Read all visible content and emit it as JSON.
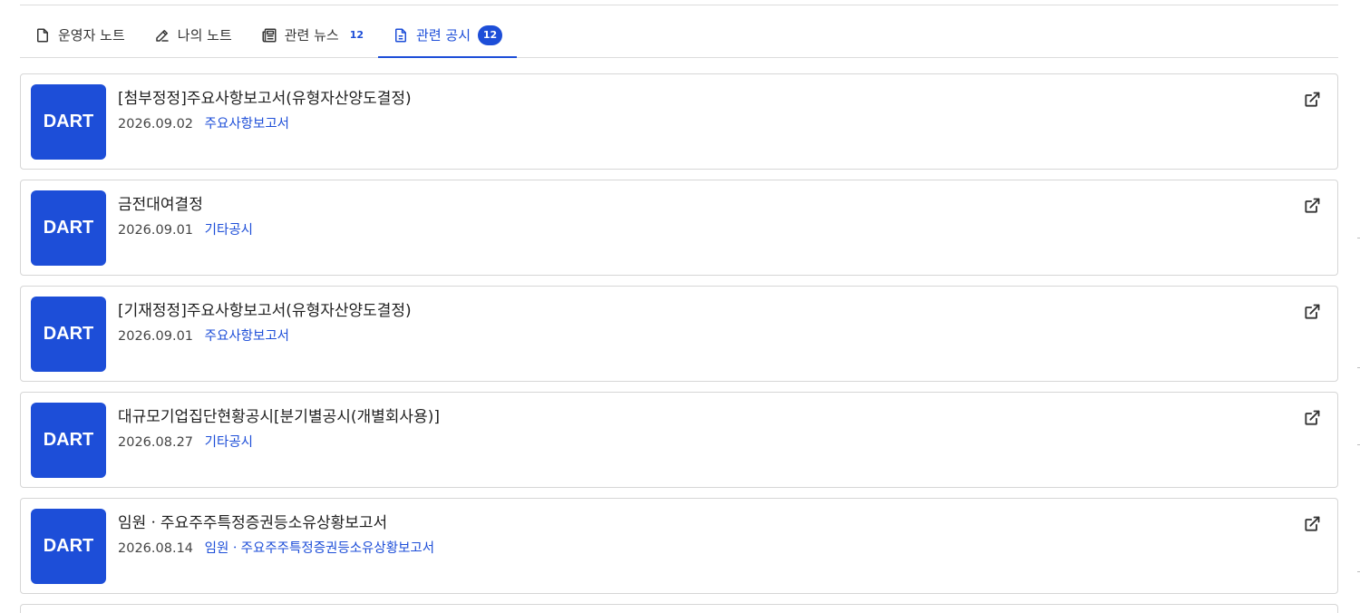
{
  "tabs": [
    {
      "label": "운영자 노트",
      "icon": "file-icon"
    },
    {
      "label": "나의 노트",
      "icon": "pencil-icon"
    },
    {
      "label": "관련 뉴스",
      "icon": "newspaper-icon",
      "count": "12"
    },
    {
      "label": "관련 공시",
      "icon": "document-icon",
      "count": "12",
      "active": true
    }
  ],
  "disclosures": [
    {
      "badge": "DART",
      "title": "[첨부정정]주요사항보고서(유형자산양도결정)",
      "date": "2026.09.02",
      "category": "주요사항보고서"
    },
    {
      "badge": "DART",
      "title": "금전대여결정",
      "date": "2026.09.01",
      "category": "기타공시"
    },
    {
      "badge": "DART",
      "title": "[기재정정]주요사항보고서(유형자산양도결정)",
      "date": "2026.09.01",
      "category": "주요사항보고서"
    },
    {
      "badge": "DART",
      "title": "대규모기업집단현황공시[분기별공시(개별회사용)]",
      "date": "2026.08.27",
      "category": "기타공시"
    },
    {
      "badge": "DART",
      "title": "임원ㆍ주요주주특정증권등소유상황보고서",
      "date": "2026.08.14",
      "category": "임원ㆍ주요주주특정증권등소유상황보고서"
    }
  ],
  "colors": {
    "accent": "#1d4ed8",
    "border": "#d6d6d6"
  }
}
